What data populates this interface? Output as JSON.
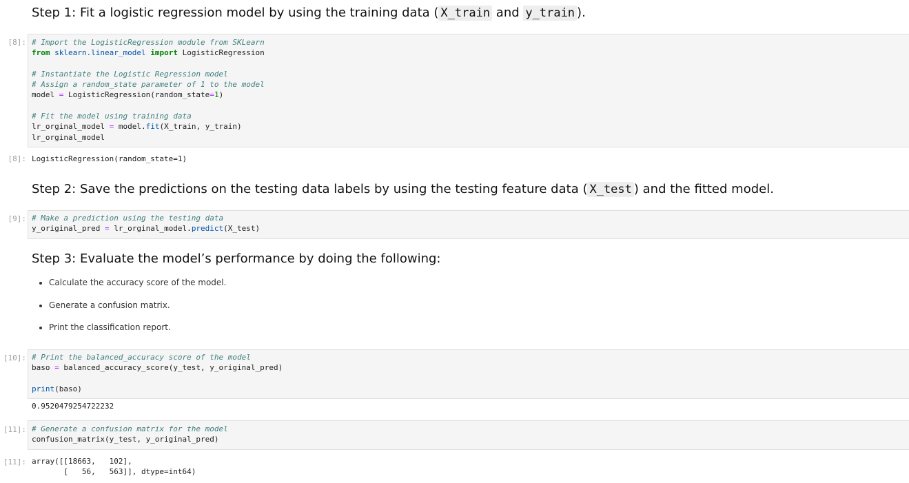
{
  "step1": {
    "text_a": "Step 1: Fit a logistic regression model by using the training data (",
    "code_a": "X_train",
    "text_b": " and ",
    "code_b": "y_train",
    "text_c": ")."
  },
  "cell8": {
    "prompt": "[8]:",
    "c1": "# Import the LogisticRegression module from SKLearn",
    "l2_kw1": "from",
    "l2_mod": "sklearn.linear_model",
    "l2_kw2": "import",
    "l2_name": "LogisticRegression",
    "c3": "# Instantiate the Logistic Regression model",
    "c4": "# Assign a random_state parameter of 1 to the model",
    "l5_a": "model",
    "l5_eq": "=",
    "l5_b": "LogisticRegression(random_state",
    "l5_eq2": "=",
    "l5_num": "1",
    "l5_c": ")",
    "c6": "# Fit the model using training data",
    "l7_a": "lr_orginal_model",
    "l7_eq": "=",
    "l7_b": "model.",
    "l7_fn": "fit",
    "l7_c": "(X_train, y_train)",
    "l8": "lr_orginal_model",
    "out_prompt": "[8]:",
    "out": "LogisticRegression(random_state=1)"
  },
  "step2": {
    "text_a": "Step 2: Save the predictions on the testing data labels by using the testing feature data (",
    "code_a": "X_test",
    "text_b": ") and the fitted model."
  },
  "cell9": {
    "prompt": "[9]:",
    "c1": "# Make a prediction using the testing data",
    "l2_a": "y_original_pred",
    "l2_eq": "=",
    "l2_b": "lr_orginal_model.",
    "l2_fn": "predict",
    "l2_c": "(X_test)"
  },
  "step3": {
    "title": "Step 3: Evaluate the model’s performance by doing the following:",
    "items": [
      "Calculate the accuracy score of the model.",
      "Generate a confusion matrix.",
      "Print the classification report."
    ]
  },
  "cell10": {
    "prompt": "[10]:",
    "c1": "# Print the balanced_accuracy score of the model",
    "l2_a": "baso",
    "l2_eq": "=",
    "l2_b": "balanced_accuracy_score(y_test, y_original_pred)",
    "l3_fn": "print",
    "l3_b": "(baso)",
    "out": "0.9520479254722232"
  },
  "cell11": {
    "prompt": "[11]:",
    "c1": "# Generate a confusion matrix for the model",
    "l2": "confusion_matrix(y_test, y_original_pred)",
    "out_prompt": "[11]:",
    "out_l1": "array([[18663,   102],",
    "out_l2": "       [   56,   563]], dtype=int64)"
  }
}
